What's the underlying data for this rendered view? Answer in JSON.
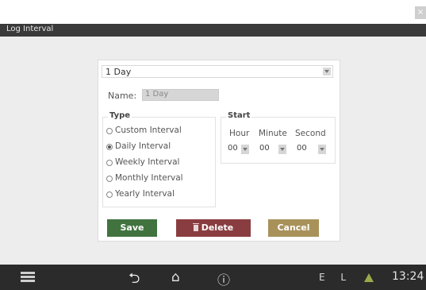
{
  "window": {
    "close_glyph": "×",
    "title": "Log Interval"
  },
  "interval_select": {
    "value": "1 Day"
  },
  "name": {
    "label": "Name:",
    "value": "1 Day"
  },
  "type": {
    "legend": "Type",
    "options": [
      {
        "label": "Custom Interval",
        "checked": false
      },
      {
        "label": "Daily Interval",
        "checked": true
      },
      {
        "label": "Weekly Interval",
        "checked": false
      },
      {
        "label": "Monthly Interval",
        "checked": false
      },
      {
        "label": "Yearly Interval",
        "checked": false
      }
    ]
  },
  "start": {
    "legend": "Start",
    "hour_label": "Hour",
    "minute_label": "Minute",
    "second_label": "Second",
    "hour_value": "00",
    "minute_value": "00",
    "second_value": "00"
  },
  "buttons": {
    "save": "Save",
    "delete": "Delete",
    "cancel": "Cancel"
  },
  "taskbar": {
    "icons": [
      "menu-icon",
      "back-icon",
      "home-icon",
      "info-icon",
      "warning-icon"
    ],
    "back_glyph": "⮌",
    "home_glyph": "⌂",
    "info_glyph": "ⓘ",
    "status_text": "E L",
    "clock": "13:24"
  },
  "colors": {
    "save": "#41733f",
    "delete": "#8a3d40",
    "cancel": "#a8925a",
    "warning": "#9aaa4a",
    "titlebar": "#3a3a3a",
    "taskbar": "#2b2b2b"
  }
}
